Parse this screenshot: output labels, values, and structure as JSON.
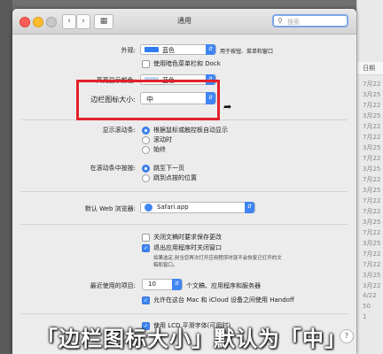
{
  "window": {
    "title": "通用"
  },
  "search": {
    "placeholder": "搜索"
  },
  "appearance": {
    "label": "外观:",
    "value": "蓝色",
    "note": "用于按钮、菜单和窗口",
    "accent_color": "#2f7bf0"
  },
  "dark_menu": {
    "label": "使用暗色菜单栏和 Dock",
    "checked": false
  },
  "highlight": {
    "label": "高亮显示颜色:",
    "value": "蓝色",
    "color": "#b8d4f3"
  },
  "sidebar_icon": {
    "label": "边栏图标大小:",
    "value": "中"
  },
  "scrollbars": {
    "label": "显示滚动条:",
    "options": [
      "根据鼠标或触控板自动显示",
      "滚动时",
      "始终"
    ],
    "selected": 0
  },
  "click_scrollbar": {
    "label": "在滚动条中按按:",
    "options": [
      "跳至下一页",
      "跳到点按的位置"
    ],
    "selected": 0
  },
  "default_browser": {
    "label": "默认 Web 浏览器:",
    "value": "Safari.app"
  },
  "documents": {
    "ask_keep": {
      "label": "关闭文稿时要求保存更改",
      "checked": false
    },
    "close_windows": {
      "label": "退出应用程序时关闭窗口",
      "checked": true
    },
    "note_line1": "如果选定,则当您再次打开应用程序时就不会恢复已打开的文",
    "note_line2": "稿和窗口。"
  },
  "recent_items": {
    "label": "最近使用的项目:",
    "value": "10",
    "suffix": "个文稿、应用程序和服务器"
  },
  "handoff": {
    "label": "允许在这台 Mac 和 iCloud 设备之间使用 Handoff",
    "checked": true
  },
  "lcd": {
    "label": "使用 LCD 平滑字体(可用时)",
    "checked": true
  },
  "caption": "「边栏图标大小」默认为「中」",
  "background": {
    "header": "日期",
    "dates": [
      "7月22",
      "3月25",
      "7月22",
      "3月25",
      "7月22",
      "7月22",
      "3月25",
      "7月22",
      "3月25",
      "7月22",
      "3月25",
      "7月22",
      "7月22",
      "3月25",
      "7月22",
      "3月25",
      "7月22",
      "7月22",
      "3月25",
      "3月22",
      "4/22",
      "50",
      "1"
    ]
  }
}
